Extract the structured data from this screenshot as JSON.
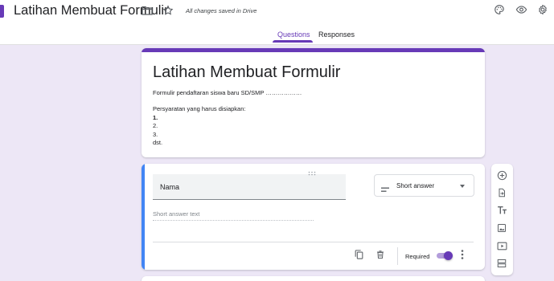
{
  "header": {
    "doc_title": "Latihan Membuat Formulir",
    "saved_status": "All changes saved in Drive",
    "icons": [
      "folder-icon",
      "star-icon",
      "palette-icon",
      "eye-icon",
      "gear-icon"
    ],
    "tabs": [
      {
        "label": "Questions",
        "active": true
      },
      {
        "label": "Responses",
        "active": false
      }
    ]
  },
  "form": {
    "title": "Latihan Membuat Formulir",
    "description_lines": [
      "Formulir pendaftaran siswa baru SD/SMP ………………",
      "",
      "Persyaratan yang harus disiapkan:",
      "1.",
      "2.",
      "3.",
      "dst."
    ]
  },
  "question": {
    "title": "Nama",
    "type": "Short answer",
    "placeholder": "Short answer text",
    "required_label": "Required",
    "required": true
  },
  "side_toolbar": [
    "add-question-icon",
    "import-questions-icon",
    "add-title-icon",
    "add-image-icon",
    "add-video-icon",
    "add-section-icon"
  ],
  "colors": {
    "accent": "#673ab7",
    "background": "#ede7f6",
    "active_question": "#4285f4"
  }
}
